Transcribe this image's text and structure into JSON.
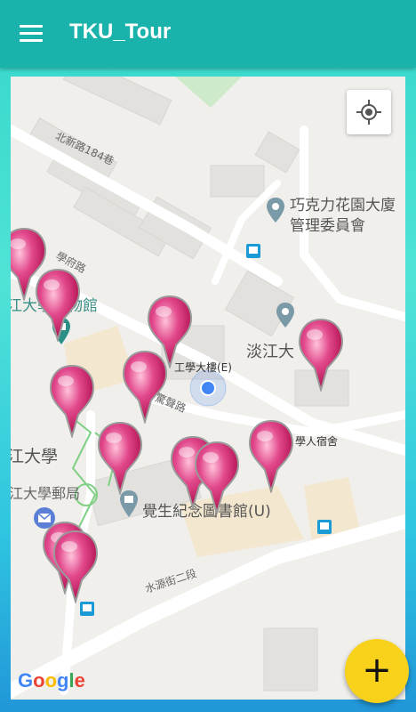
{
  "appbar": {
    "title": "TKU_Tour",
    "menu_icon": "hamburger-menu-icon"
  },
  "map": {
    "labels": {
      "road_beixin": "北新路184巷",
      "road_xuefu": "學府路",
      "road_jingpan": "驚聲路",
      "road_shuiyuan": "水源街二段",
      "poi_chocolate_line1": "巧克力花園大廈",
      "poi_chocolate_line2": "管理委員會",
      "museum": "江大學博物館",
      "tamkang_building": "淡江大",
      "engineering_building": "工學大樓(E)",
      "dorm": "學人宿舍",
      "university": "江大學",
      "post_office": "江大學郵局",
      "library": "覺生紀念圖書館(U)"
    },
    "my_location_icon": "my-location-crosshair-icon",
    "attribution": "Google",
    "marker_color": "#d81b60",
    "marker_count": 14
  },
  "fab": {
    "label": "+",
    "icon": "add-icon",
    "color": "#f7d11a"
  }
}
